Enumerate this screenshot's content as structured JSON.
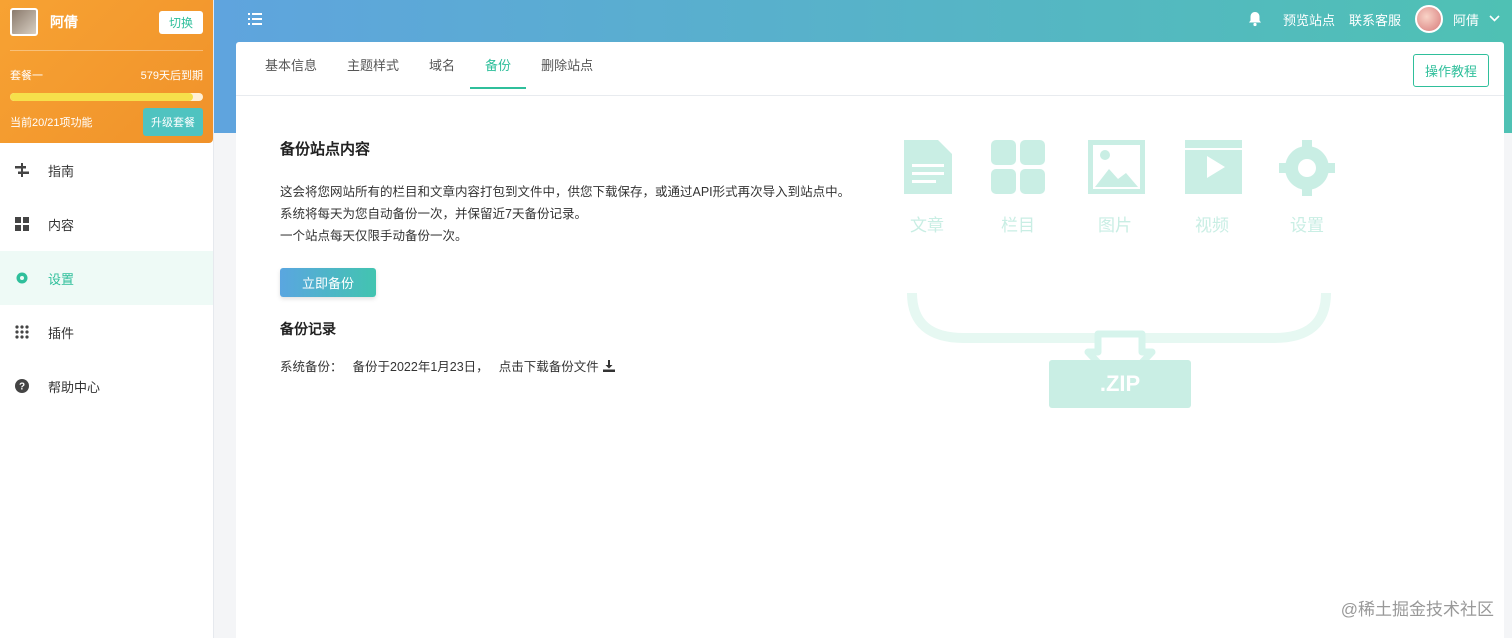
{
  "account": {
    "name": "阿倩",
    "switch_label": "切换",
    "plan_name": "套餐一",
    "expire": "579天后到期",
    "progress_percent": 95,
    "features": "当前20/21项功能",
    "upgrade_label": "升级套餐"
  },
  "sidebar": {
    "items": [
      {
        "label": "指南",
        "icon": "guide-icon"
      },
      {
        "label": "内容",
        "icon": "grid-icon"
      },
      {
        "label": "设置",
        "icon": "gear-icon"
      },
      {
        "label": "插件",
        "icon": "dots-grid-icon"
      },
      {
        "label": "帮助中心",
        "icon": "help-icon"
      }
    ],
    "active_index": 2
  },
  "header": {
    "preview": "预览站点",
    "support": "联系客服",
    "user": "阿倩"
  },
  "tabs": [
    "基本信息",
    "主题样式",
    "域名",
    "备份",
    "删除站点"
  ],
  "active_tab": 3,
  "tutorial_label": "操作教程",
  "backup": {
    "title": "备份站点内容",
    "lines": [
      "这会将您网站所有的栏目和文章内容打包到文件中，供您下载保存，或通过API形式再次导入到站点中。",
      "系统将每天为您自动备份一次，并保留近7天备份记录。",
      "一个站点每天仅限手动备份一次。"
    ],
    "button": "立即备份",
    "records_title": "备份记录",
    "record": {
      "type": "系统备份：",
      "time": "备份于2022年1月23日，",
      "download": "点击下载备份文件"
    }
  },
  "illustration": {
    "labels": [
      "文章",
      "栏目",
      "图片",
      "视频",
      "设置"
    ],
    "zip": ".ZIP",
    "color": "#c9eee4"
  },
  "watermark": "@稀土掘金技术社区",
  "colors": {
    "accent": "#2fbf9b",
    "plan_orange": "#f39a2e"
  }
}
